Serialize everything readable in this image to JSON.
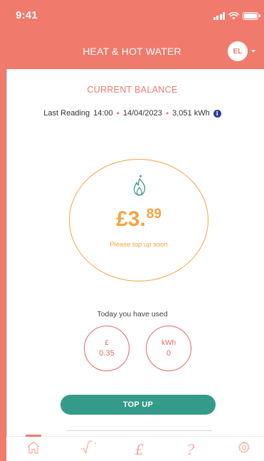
{
  "status_bar": {
    "time": "9:41"
  },
  "header": {
    "title": "HEAT & HOT WATER",
    "avatar_initials": "EL"
  },
  "balance": {
    "heading": "CURRENT BALANCE",
    "last_reading_label": "Last Reading",
    "reading_time": "14:00",
    "reading_date": "14/04/2023",
    "reading_value": "3,051 kWh",
    "separator": "•",
    "info_glyph": "i",
    "amount_main": "£3.",
    "amount_pence": "89",
    "note": "Please top up soon"
  },
  "usage": {
    "heading": "Today you have used",
    "money_unit": "£",
    "money_value": "0.35",
    "energy_unit": "kWh",
    "energy_value": "0"
  },
  "actions": {
    "topup_label": "TOP UP"
  },
  "tabbar": {
    "items": [
      {
        "icon": "home-icon",
        "active": true
      },
      {
        "icon": "graph-icon",
        "active": false
      },
      {
        "icon": "pound-icon",
        "glyph": "£",
        "active": false
      },
      {
        "icon": "help-icon",
        "glyph": "?",
        "active": false
      },
      {
        "icon": "settings-icon",
        "active": false
      }
    ]
  },
  "colors": {
    "brand_coral": "#f07a6c",
    "balance_orange": "#f5a340",
    "usage_red": "#e0686a",
    "button_teal": "#349a8a",
    "info_blue": "#2b3d8f"
  }
}
